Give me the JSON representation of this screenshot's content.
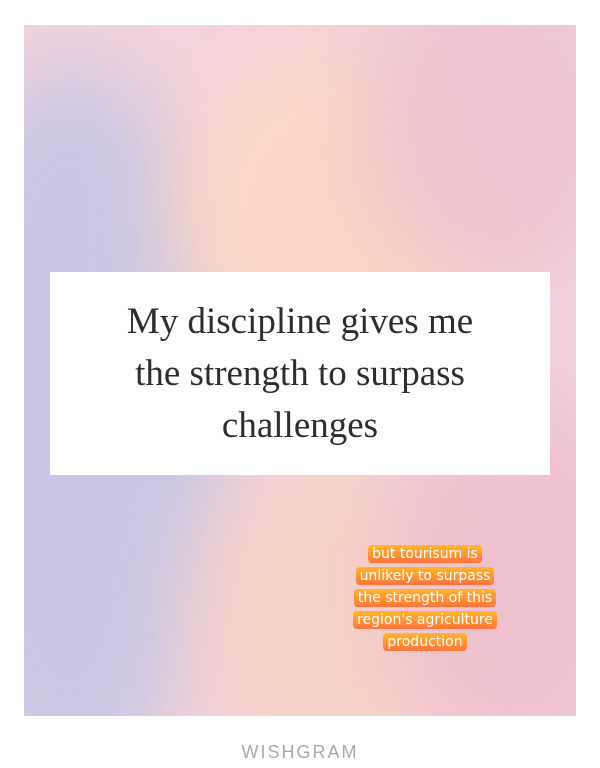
{
  "quote": {
    "text": "My discipline gives me the strength to surpass challenges"
  },
  "caption": {
    "text": "but tourisum is unlikely to surpass the strength of this region's agriculture production"
  },
  "brand": {
    "name": "WISHGRAM"
  },
  "colors": {
    "caption_gradient_top": "#ffb62c",
    "caption_gradient_bottom": "#ff7340",
    "background_lavender": "#c8c6e4",
    "background_peach": "#fdd6c3",
    "background_pink": "#f0c2d0",
    "brand_gray": "#a9a9a9"
  }
}
